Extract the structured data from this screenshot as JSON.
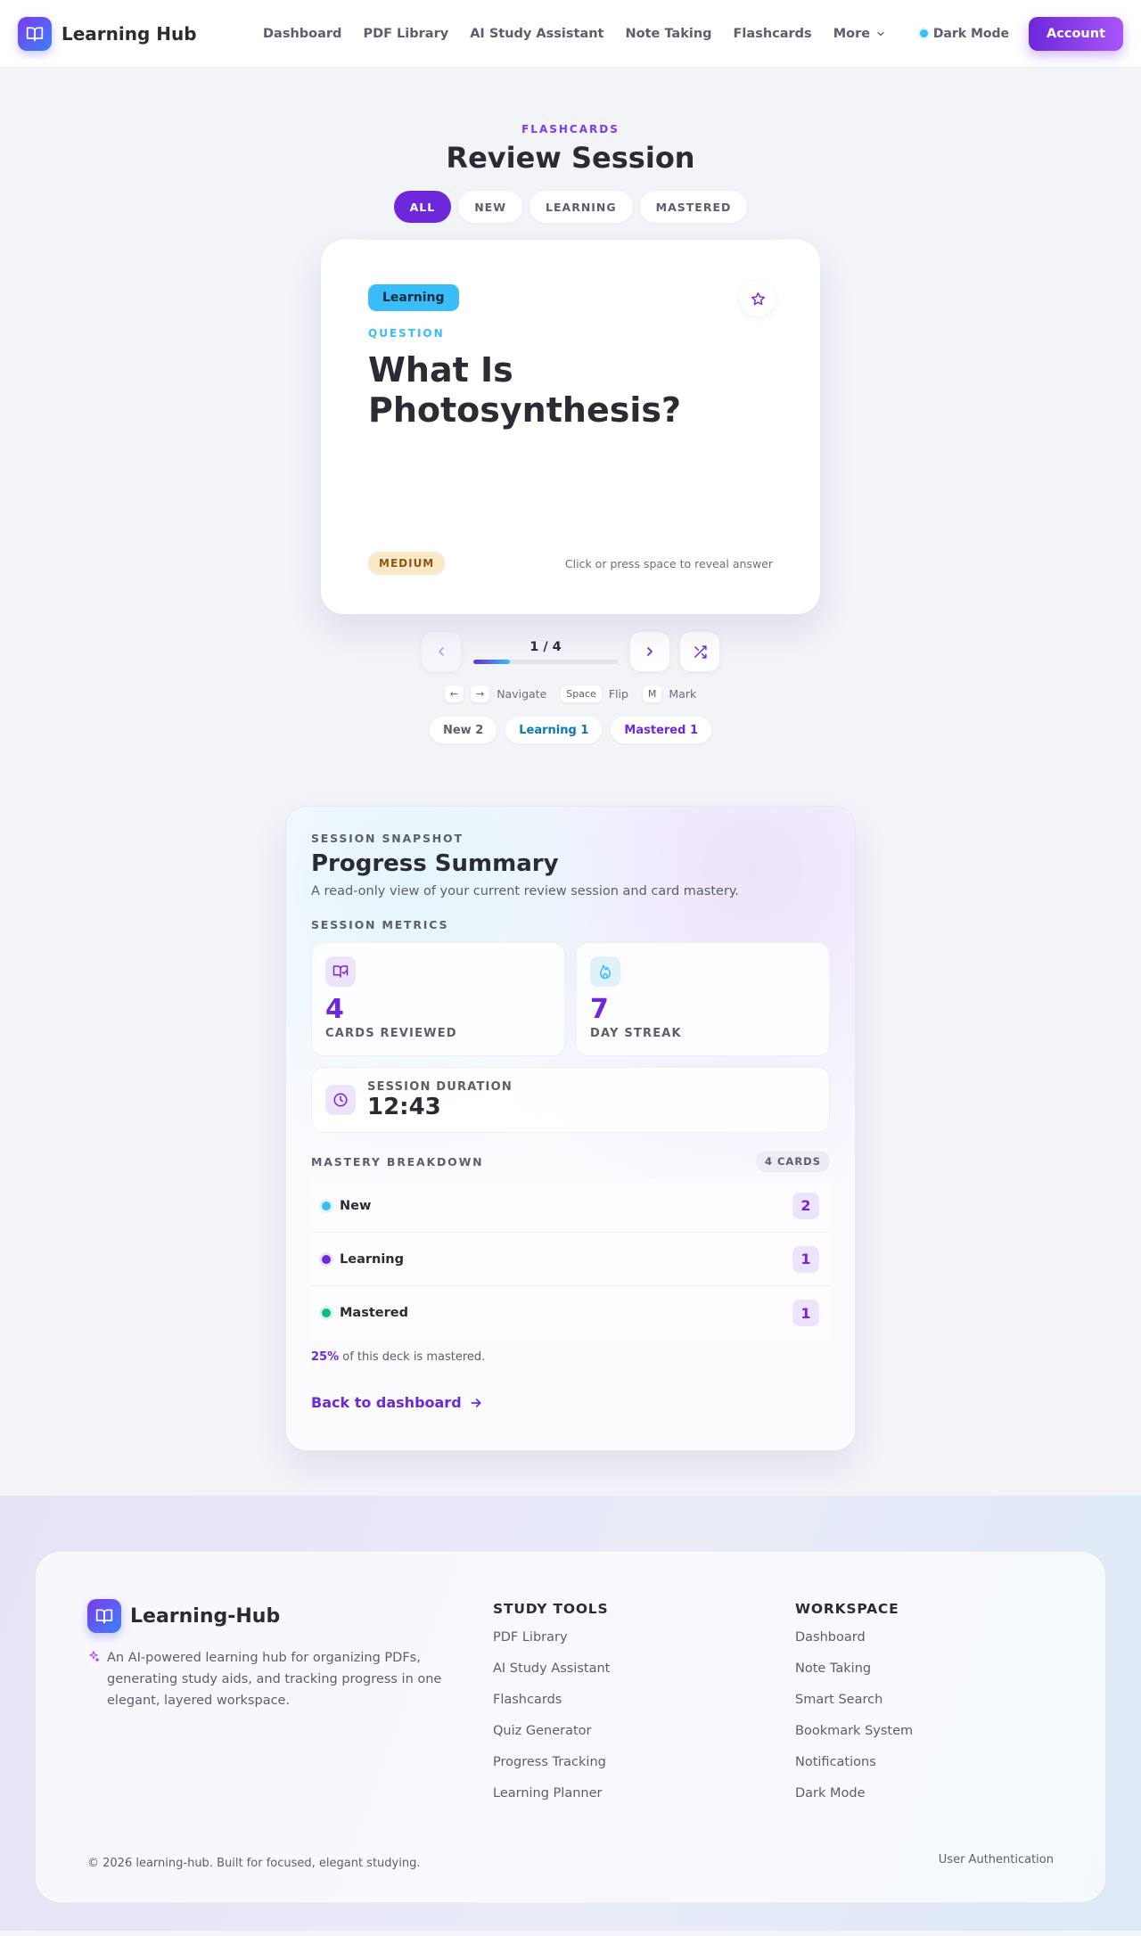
{
  "nav": {
    "brand": "Learning Hub",
    "links": [
      "Dashboard",
      "PDF Library",
      "AI Study Assistant",
      "Note Taking",
      "Flashcards"
    ],
    "more": "More",
    "dark_mode": "Dark Mode",
    "account": "Account"
  },
  "review": {
    "eyebrow": "FLASHCARDS",
    "title": "Review Session",
    "filters": [
      "ALL",
      "NEW",
      "LEARNING",
      "MASTERED"
    ],
    "active_filter": "ALL",
    "card": {
      "status": "Learning",
      "question_label": "QUESTION",
      "question": "What Is Photosynthesis?",
      "difficulty": "MEDIUM",
      "hint": "Click or press space to reveal answer"
    },
    "counter": "1 / 4",
    "progress": 0.25,
    "shortcuts": {
      "prev_key": "←",
      "next_key": "→",
      "navigate": "Navigate",
      "space_key": "Space",
      "flip": "Flip",
      "mark_key": "M",
      "mark": "Mark"
    },
    "counts": {
      "new": "New 2",
      "learning": "Learning 1",
      "mastered": "Mastered 1"
    }
  },
  "summary": {
    "eyebrow": "SESSION SNAPSHOT",
    "title": "Progress Summary",
    "description": "A read-only view of your current review session and card mastery.",
    "metrics_label": "SESSION METRICS",
    "metrics": [
      {
        "value": "4",
        "label": "CARDS REVIEWED"
      },
      {
        "value": "7",
        "label": "DAY STREAK"
      }
    ],
    "duration_label": "SESSION DURATION",
    "duration_value": "12:43",
    "mastery_label": "MASTERY BREAKDOWN",
    "mastery_count": "4 CARDS",
    "mastery": [
      {
        "name": "New",
        "count": "2",
        "color": "#38bdf8"
      },
      {
        "name": "Learning",
        "count": "1",
        "color": "#6d28d9"
      },
      {
        "name": "Mastered",
        "count": "1",
        "color": "#10b981"
      }
    ],
    "mastery_percent": "25%",
    "mastery_note": "of this deck is mastered.",
    "back_link": "Back to dashboard"
  },
  "footer": {
    "brand": "Learning-Hub",
    "description": "An AI-powered learning hub for organizing PDFs, generating study aids, and tracking progress in one elegant, layered workspace.",
    "study_tools_title": "STUDY TOOLS",
    "study_tools": [
      "PDF Library",
      "AI Study Assistant",
      "Flashcards",
      "Quiz Generator",
      "Progress Tracking",
      "Learning Planner"
    ],
    "workspace_title": "WORKSPACE",
    "workspace": [
      "Dashboard",
      "Note Taking",
      "Smart Search",
      "Bookmark System",
      "Notifications",
      "Dark Mode"
    ],
    "copyright": "© 2026 learning-hub. Built for focused, elegant studying.",
    "auth": "User Authentication"
  },
  "colors": {
    "accent": "#6d28d9",
    "cyan": "#38bdf8",
    "green": "#10b981",
    "background": "#f2f4f8"
  }
}
